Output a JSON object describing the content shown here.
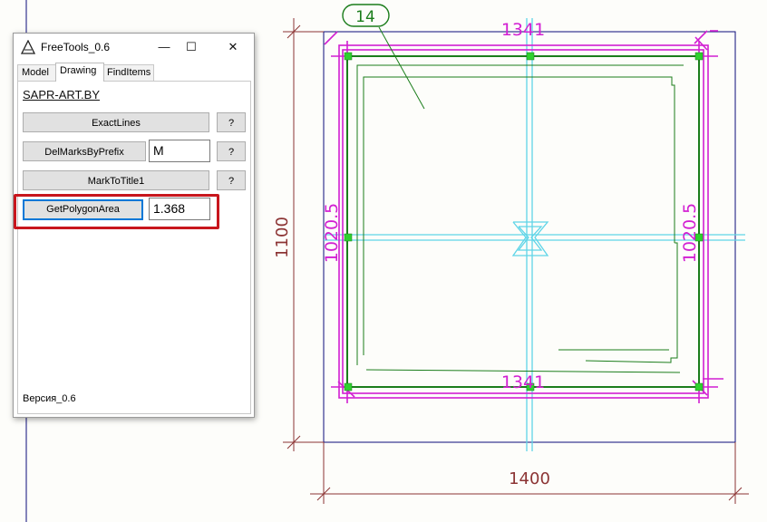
{
  "drawing": {
    "leader_label": "14",
    "dim_top": "1341",
    "dim_bottom": "1341",
    "dim_left": "1020.5",
    "dim_right": "1020.5",
    "dim_height": "1100",
    "dim_width": "1400",
    "colors": {
      "magenta": "#d21fd2",
      "green": "#1b7d1b",
      "cyan": "#5fd5e8",
      "navy": "#0b0b7a",
      "dimension": "#8c3434"
    }
  },
  "window": {
    "title": "FreeTools_0.6",
    "minimize": "—",
    "maximize": "☐",
    "close": "✕",
    "tabs": [
      {
        "label": "Model"
      },
      {
        "label": "Drawing"
      },
      {
        "label": "FindItems"
      }
    ],
    "link": "SAPR-ART.BY",
    "buttons": {
      "exact_lines": "ExactLines",
      "del_marks": "DelMarksByPrefix",
      "mark_to_title": "MarkToTitle1",
      "get_polygon_area": "GetPolygonArea",
      "help": "?"
    },
    "inputs": {
      "prefix_value": "M",
      "area_value": "1.368"
    },
    "status": "Версия_0.6"
  }
}
